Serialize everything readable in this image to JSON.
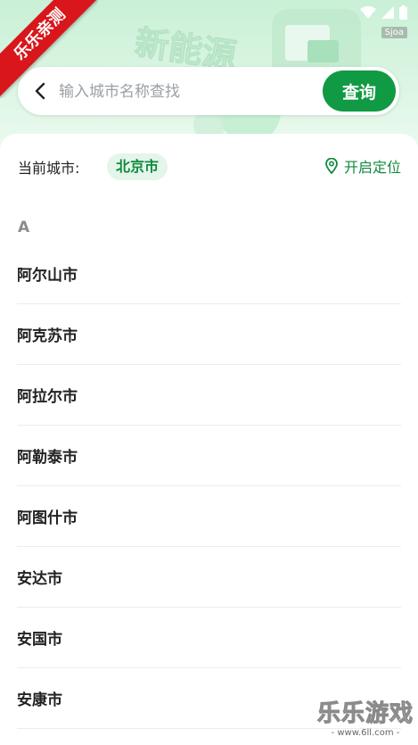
{
  "status_bar": {
    "version_badge": "Sjoa"
  },
  "ribbon": {
    "text": "乐乐亲测"
  },
  "hero": {
    "banner_text": "新能源"
  },
  "search": {
    "placeholder": "输入城市名称查找",
    "button_label": "查询"
  },
  "current_city": {
    "label": "当前城市:",
    "value": "北京市",
    "locate_label": "开启定位"
  },
  "sections": [
    {
      "letter": "A",
      "cities": [
        "阿尔山市",
        "阿克苏市",
        "阿拉尔市",
        "阿勒泰市",
        "阿图什市",
        "安达市",
        "安国市",
        "安康市"
      ]
    }
  ],
  "watermark": {
    "main": "乐乐游戏",
    "sub": "- www.6ll.com -"
  },
  "colors": {
    "brand_green": "#109a43",
    "ribbon_red": "#d8161b",
    "chip_bg": "#e4f5ea"
  }
}
